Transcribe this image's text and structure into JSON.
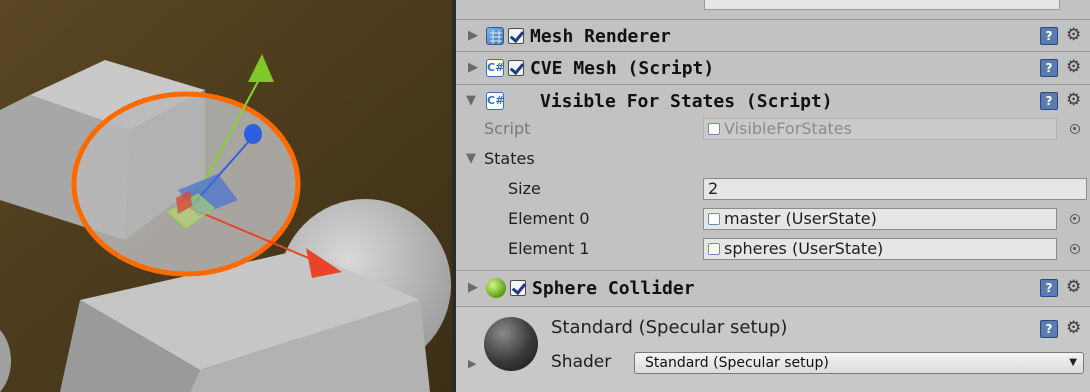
{
  "components": {
    "mesh_renderer": {
      "title": "Mesh Renderer",
      "enabled": true
    },
    "cve_mesh": {
      "title": "CVE Mesh (Script)",
      "enabled": true
    },
    "visible_for_states": {
      "title": "Visible For States (Script)",
      "script_label": "Script",
      "script_value": "VisibleForStates",
      "states_label": "States",
      "size_label": "Size",
      "size_value": "2",
      "elements": [
        {
          "label": "Element 0",
          "value": "master (UserState)"
        },
        {
          "label": "Element 1",
          "value": "spheres (UserState)"
        }
      ]
    },
    "sphere_collider": {
      "title": "Sphere Collider",
      "enabled": true
    }
  },
  "material": {
    "name": "Standard (Specular setup)",
    "shader_label": "Shader",
    "shader_value": "Standard (Specular setup)"
  },
  "icons": {
    "help": "help-icon",
    "settings": "gear-icon",
    "picker": "object-picker-icon"
  },
  "colors": {
    "scene_background": "#4a3a1e",
    "inspector_background": "#c2c2c2",
    "selection_outline": "#ff6a00",
    "gizmo_x": "#e8442a",
    "gizmo_y": "#8ad032",
    "gizmo_z": "#2f5ee0"
  }
}
